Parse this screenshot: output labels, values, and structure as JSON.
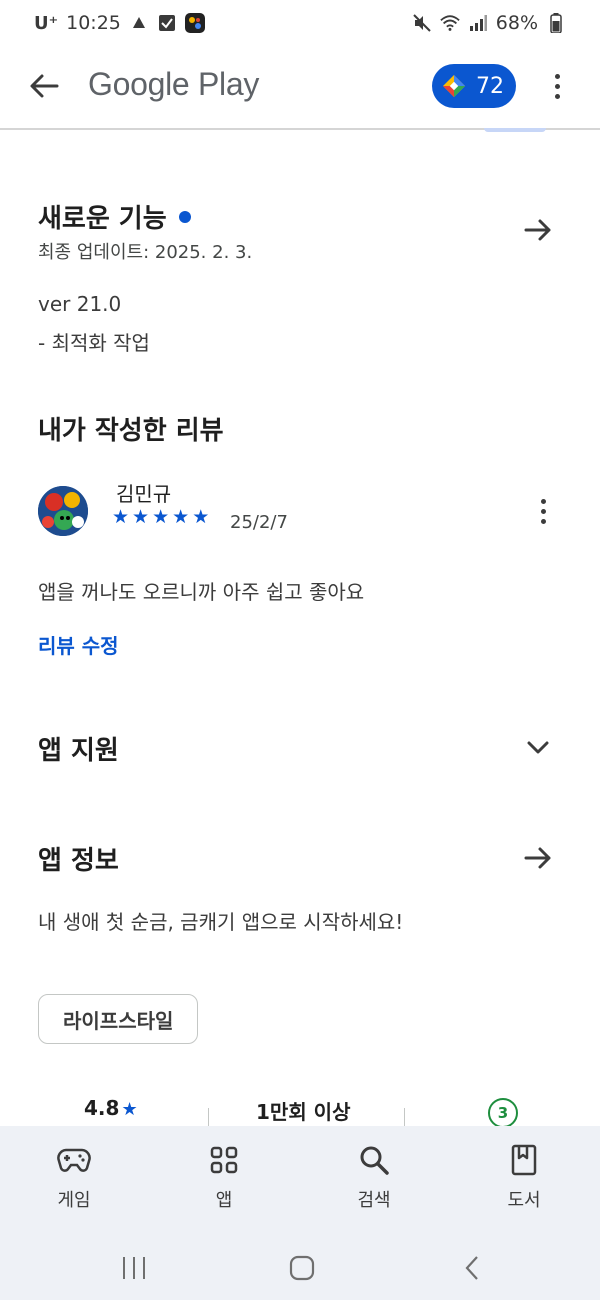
{
  "status_bar": {
    "carrier": "U⁺",
    "time": "10:25",
    "battery": "68%"
  },
  "app_bar": {
    "brand": "Google Play",
    "points": "72"
  },
  "whats_new": {
    "title": "새로운 기능",
    "last_updated": "최종 업데이트: 2025. 2. 3.",
    "version": "ver 21.0",
    "note": "- 최적화 작업"
  },
  "my_review": {
    "title": "내가 작성한 리뷰",
    "reviewer": "김민규",
    "rating": 5,
    "date": "25/2/7",
    "body": "앱을 꺼나도 오르니까 아주 쉽고 좋아요",
    "edit_label": "리뷰 수정"
  },
  "app_support": {
    "title": "앱 지원"
  },
  "app_info": {
    "title": "앱 정보",
    "description": "내 생애 첫 순금, 금캐기 앱으로 시작하세요!",
    "category_chip": "라이프스타일"
  },
  "stats": {
    "rating": "4.8",
    "downloads": "1만회 이상",
    "age_rating": "3"
  },
  "bottom_nav": {
    "items": [
      {
        "label": "게임",
        "icon": "gamepad-icon"
      },
      {
        "label": "앱",
        "icon": "apps-grid-icon"
      },
      {
        "label": "검색",
        "icon": "search-icon"
      },
      {
        "label": "도서",
        "icon": "book-icon"
      }
    ]
  },
  "colors": {
    "accent": "#0b57d0",
    "nav_background": "#eef1f6",
    "age_rating_green": "#1e8e3e"
  }
}
